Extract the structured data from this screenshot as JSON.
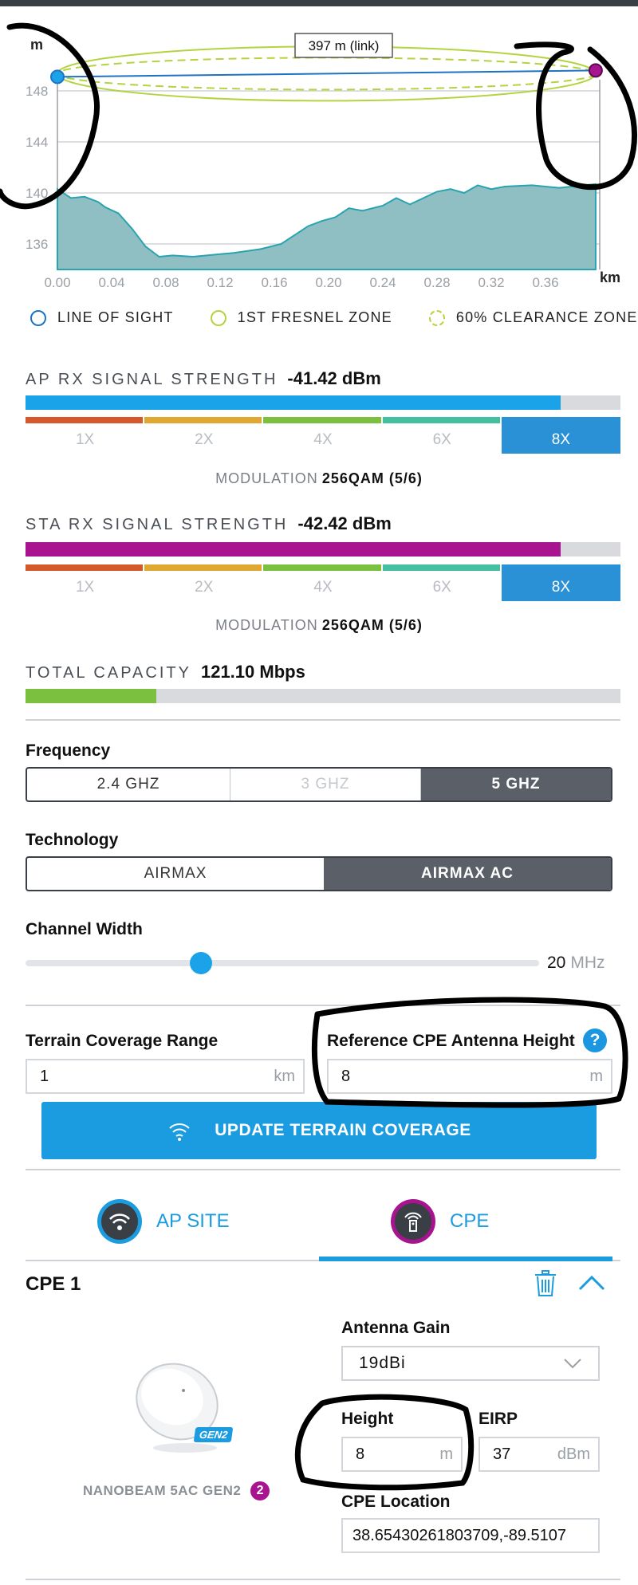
{
  "chart_data": {
    "type": "area",
    "title": "397 m (link)",
    "ylabel": "m",
    "xlabel": "km",
    "x_ticks": [
      "0.00",
      "0.04",
      "0.08",
      "0.12",
      "0.16",
      "0.20",
      "0.24",
      "0.28",
      "0.32",
      "0.36"
    ],
    "y_ticks": [
      "148",
      "144",
      "140",
      "136"
    ],
    "xlim": [
      0,
      0.4
    ],
    "ylim": [
      134,
      152
    ],
    "terrain": {
      "x": [
        0.0,
        0.01,
        0.02,
        0.03,
        0.035,
        0.045,
        0.055,
        0.065,
        0.075,
        0.085,
        0.1,
        0.12,
        0.13,
        0.15,
        0.165,
        0.175,
        0.185,
        0.195,
        0.205,
        0.215,
        0.225,
        0.24,
        0.25,
        0.26,
        0.27,
        0.28,
        0.29,
        0.3,
        0.31,
        0.32,
        0.33,
        0.35,
        0.37,
        0.397
      ],
      "y": [
        140.3,
        139.6,
        139.7,
        139.3,
        138.9,
        138.4,
        137.2,
        135.8,
        135.0,
        135.1,
        135.0,
        135.2,
        135.3,
        135.6,
        136.0,
        136.7,
        137.4,
        137.8,
        138.1,
        138.8,
        138.6,
        139.0,
        139.6,
        139.1,
        139.6,
        140.1,
        140.3,
        140.0,
        140.6,
        140.3,
        140.5,
        140.6,
        140.4,
        140.7
      ]
    },
    "endpoints": {
      "ap_height": 149.1,
      "cpe_height": 149.6
    },
    "legend": [
      "LINE OF SIGHT",
      "1ST FRESNEL ZONE",
      "60% CLEARANCE ZONE"
    ],
    "series": [
      {
        "name": "LINE OF SIGHT",
        "color": "#1f73c4"
      },
      {
        "name": "1ST FRESNEL ZONE",
        "color": "#b3d440"
      },
      {
        "name": "60% CLEARANCE ZONE",
        "color": "#b3d440"
      }
    ]
  },
  "ap_rx": {
    "label": "AP RX SIGNAL STRENGTH",
    "value": "-41.42 dBm",
    "fill_fraction": 0.9,
    "color": "#1aa3e8",
    "modulation_key": "MODULATION",
    "modulation_value": "256QAM (5/6)"
  },
  "sta_rx": {
    "label": "STA RX SIGNAL STRENGTH",
    "value": "-42.42 dBm",
    "fill_fraction": 0.9,
    "color": "#a8148f",
    "modulation_key": "MODULATION",
    "modulation_value": "256QAM (5/6)"
  },
  "modulation_levels": [
    {
      "label": "1X",
      "color": "#d4582a"
    },
    {
      "label": "2X",
      "color": "#e0a830"
    },
    {
      "label": "4X",
      "color": "#7cc040"
    },
    {
      "label": "6X",
      "color": "#44c0a0"
    },
    {
      "label": "8X",
      "color": "#2a91d6",
      "active": true
    }
  ],
  "capacity": {
    "label": "TOTAL CAPACITY",
    "value": "121.10 Mbps",
    "fill_fraction": 0.22,
    "color": "#7cc040"
  },
  "frequency": {
    "label": "Frequency",
    "options": [
      "2.4 GHZ",
      "3 GHZ",
      "5 GHZ"
    ],
    "selected": "5 GHZ"
  },
  "technology": {
    "label": "Technology",
    "options": [
      "AIRMAX",
      "AIRMAX AC"
    ],
    "selected": "AIRMAX AC"
  },
  "channel_width": {
    "label": "Channel Width",
    "value": "20",
    "unit": "MHz",
    "level_fraction": 0.27
  },
  "terrain_range": {
    "label": "Terrain Coverage Range",
    "value": "1",
    "unit": "km"
  },
  "ref_cpe_height": {
    "label": "Reference CPE Antenna Height",
    "value": "8",
    "unit": "m",
    "help": "?"
  },
  "update_button": {
    "label": "UPDATE TERRAIN COVERAGE",
    "icon": "wifi-icon"
  },
  "tabs": [
    {
      "label": "AP SITE",
      "icon": "ap-router-icon"
    },
    {
      "label": "CPE",
      "icon": "cpe-antenna-icon",
      "active": true
    }
  ],
  "cpe": {
    "title": "CPE 1",
    "antenna_gain_label": "Antenna Gain",
    "antenna_gain_value": "19dBi",
    "height_label": "Height",
    "height_value": "8",
    "height_unit": "m",
    "eirp_label": "EIRP",
    "eirp_value": "37",
    "eirp_unit": "dBm",
    "location_label": "CPE Location",
    "location_value": "38.65430261803709,-89.5107",
    "device_name": "NANOBEAM 5AC GEN2",
    "device_badge": "2",
    "device_logo_text": "GEN2"
  },
  "colors": {
    "accent": "#1b9be0",
    "dark": "#5b6068",
    "magenta": "#a8148f"
  }
}
